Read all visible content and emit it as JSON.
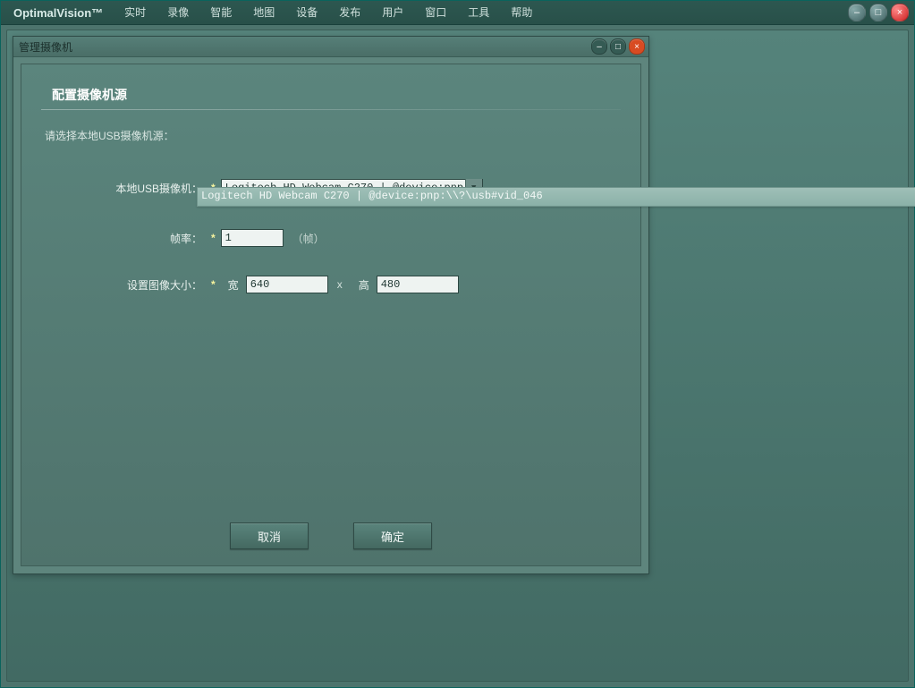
{
  "app": {
    "brand": "OptimalVision™",
    "menu": [
      "实时",
      "录像",
      "智能",
      "地图",
      "设备",
      "发布",
      "用户",
      "窗口",
      "工具",
      "帮助"
    ],
    "window_controls": {
      "min_glyph": "–",
      "max_glyph": "□",
      "close_glyph": "×"
    }
  },
  "child_window": {
    "title": "管理摄像机",
    "controls": {
      "min_glyph": "–",
      "max_glyph": "□",
      "close_glyph": "×"
    },
    "section_header": "配置摄像机源",
    "prompt": "请选择本地USB摄像机源：",
    "fields": {
      "camera_label": "本地USB摄像机：",
      "camera_value": "Logitech HD Webcam C270 | @device:pnp:\\\\?\\",
      "camera_dropdown_option": "Logitech HD Webcam C270 | @device:pnp:\\\\?\\usb#vid_046",
      "fps_label": "帧率：",
      "fps_value": "1",
      "fps_unit": "（帧）",
      "size_label": "设置图像大小：",
      "width_label": "宽",
      "width_value": "640",
      "x_sep": "x",
      "height_label": "高",
      "height_value": "480"
    },
    "buttons": {
      "cancel": "取消",
      "ok": "确定"
    },
    "required_mark": "*"
  }
}
